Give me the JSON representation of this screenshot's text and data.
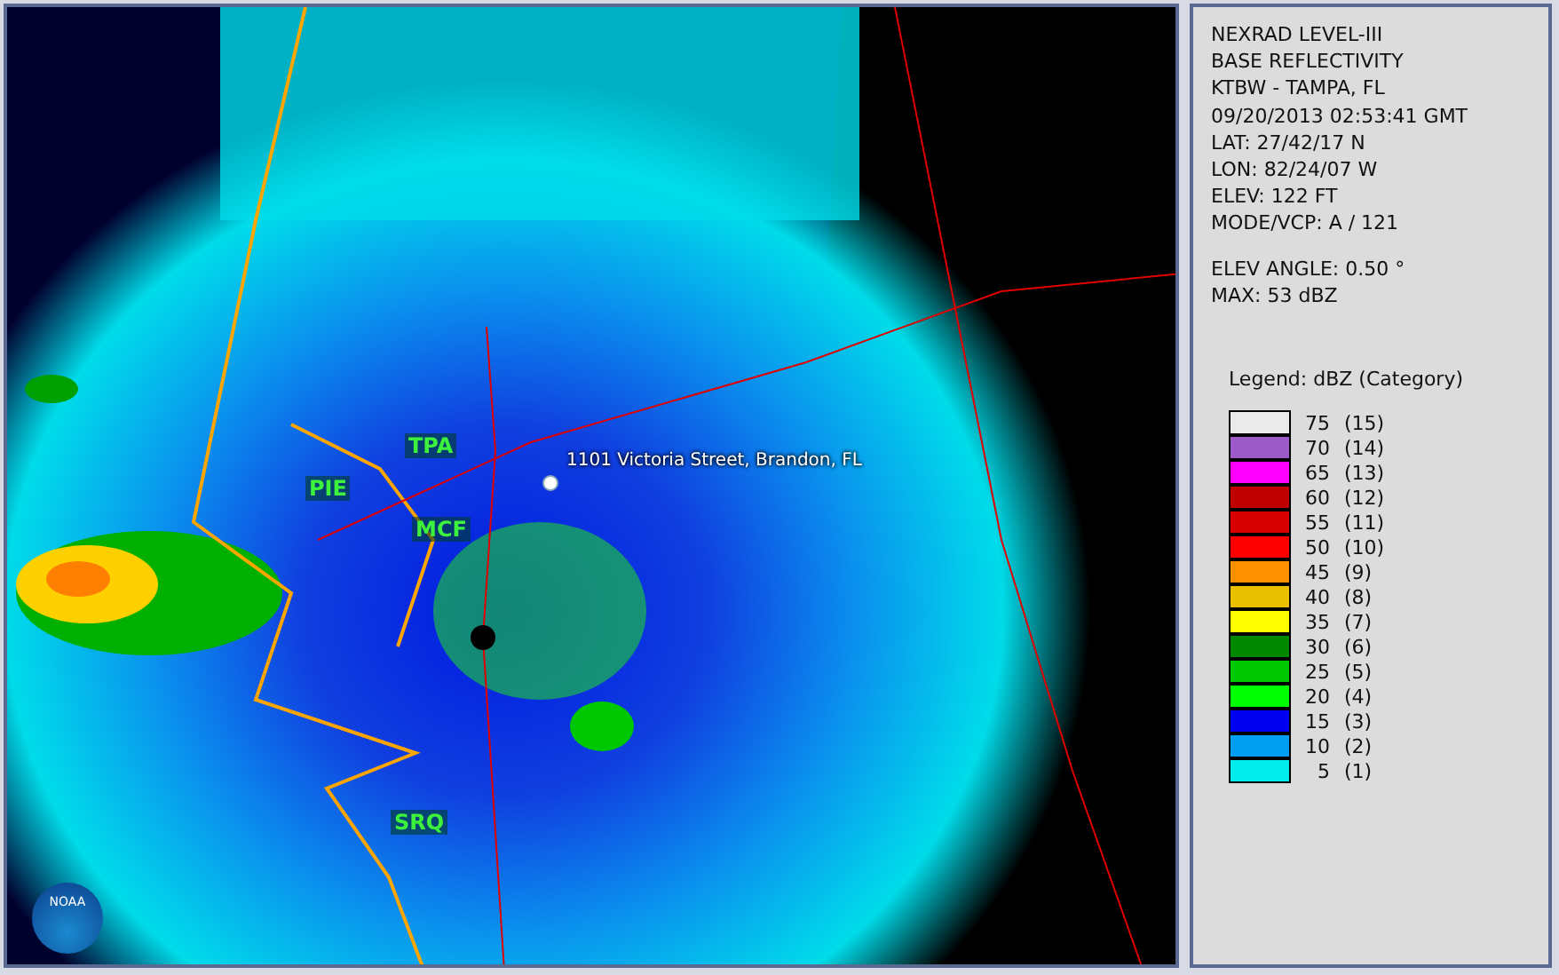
{
  "map": {
    "places": [
      {
        "label": "TPA",
        "kind": "city"
      },
      {
        "label": "PIE",
        "kind": "city"
      },
      {
        "label": "MCF",
        "kind": "city"
      },
      {
        "label": "SRQ",
        "kind": "city"
      },
      {
        "label": "1101 Victoria Street, Brandon, FL",
        "kind": "address"
      }
    ],
    "logo_text": "NOAA"
  },
  "info": {
    "lines": [
      "NEXRAD LEVEL-III",
      "BASE REFLECTIVITY",
      "KTBW - TAMPA, FL",
      "09/20/2013 02:53:41 GMT",
      "LAT: 27/42/17 N",
      "LON: 82/24/07 W",
      "ELEV: 122 FT",
      "MODE/VCP: A / 121"
    ],
    "extra_lines": [
      "ELEV ANGLE: 0.50 °",
      "MAX: 53 dBZ"
    ]
  },
  "legend": {
    "title": "Legend: dBZ (Category)",
    "items": [
      {
        "value": "75",
        "category": "(15)",
        "color": "#eaeaea"
      },
      {
        "value": "70",
        "category": "(14)",
        "color": "#9c5ac8"
      },
      {
        "value": "65",
        "category": "(13)",
        "color": "#ff00ff"
      },
      {
        "value": "60",
        "category": "(12)",
        "color": "#c00000"
      },
      {
        "value": "55",
        "category": "(11)",
        "color": "#d80000"
      },
      {
        "value": "50",
        "category": "(10)",
        "color": "#ff0000"
      },
      {
        "value": "45",
        "category": "(9)",
        "color": "#ff9000"
      },
      {
        "value": "40",
        "category": "(8)",
        "color": "#e8c000"
      },
      {
        "value": "35",
        "category": "(7)",
        "color": "#ffff00"
      },
      {
        "value": "30",
        "category": "(6)",
        "color": "#008800"
      },
      {
        "value": "25",
        "category": "(5)",
        "color": "#00c800"
      },
      {
        "value": "20",
        "category": "(4)",
        "color": "#00ff00"
      },
      {
        "value": "15",
        "category": "(3)",
        "color": "#0000f0"
      },
      {
        "value": "10",
        "category": "(2)",
        "color": "#009ef0"
      },
      {
        "value": "5",
        "category": "(1)",
        "color": "#00ecec"
      }
    ]
  }
}
